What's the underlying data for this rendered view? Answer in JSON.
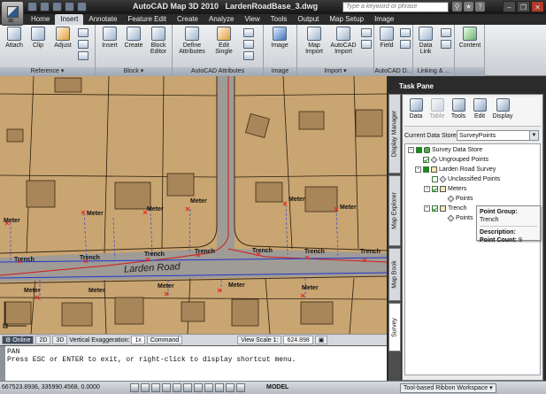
{
  "window": {
    "app_title": "AutoCAD Map 3D 2010",
    "file_name": "LardenRoadBase_3.dwg",
    "app_button_label": "3D",
    "search_placeholder": "Type a keyword or phrase",
    "minimize": "–",
    "restore": "❐",
    "close": "✕"
  },
  "ribbon": {
    "tabs": [
      "Home",
      "Insert",
      "Annotate",
      "Feature Edit",
      "Create",
      "Analyze",
      "View",
      "Tools",
      "Output",
      "Map Setup",
      "Image"
    ],
    "active_tab": "Insert",
    "panels": {
      "reference": {
        "title": "Reference ▾",
        "tools": [
          "Attach",
          "Clip",
          "Adjust"
        ]
      },
      "block": {
        "title": "Block ▾",
        "tools": [
          "Insert",
          "Create",
          "Block Editor"
        ]
      },
      "attributes": {
        "title": "AutoCAD Attributes",
        "tools": [
          "Define Attributes",
          "Edit Single"
        ]
      },
      "image": {
        "title": "Image",
        "tools": [
          "Image"
        ]
      },
      "import": {
        "title": "Import ▾",
        "tools": [
          "Map Import",
          "AutoCAD Import"
        ]
      },
      "data": {
        "title": "AutoCAD D...",
        "tools": [
          "Field"
        ]
      },
      "linking": {
        "title": "Linking & ...",
        "tools": [
          "Data Link"
        ]
      },
      "content": {
        "title": "",
        "tools": [
          "Content"
        ]
      }
    }
  },
  "map": {
    "road_label": "Larden Road",
    "point_labels": {
      "meter": "Meter",
      "trench": "Trench"
    }
  },
  "ucs_bar": {
    "online": "Online",
    "view2d": "2D",
    "view3d": "3D",
    "vert_exag_label": "Vertical Exaggeration:",
    "vert_exag_value": "1x",
    "command": "Command",
    "view_scale_label": "View Scale 1:",
    "view_scale_value": "624.898"
  },
  "command_window": {
    "line1": "PAN",
    "line2": "Press ESC or ENTER to exit, or right-click to display shortcut menu."
  },
  "statusbar": {
    "coordinates": "667523.8936, 335990.4568, 0.0000",
    "model": "MODEL",
    "workspace": "Tool-based Ribbon Workspace ▾"
  },
  "task_pane": {
    "title": "Task Pane",
    "side_tabs": [
      "Display Manager",
      "Map Explorer",
      "Map Book",
      "Survey"
    ],
    "toolbar": [
      "Data",
      "Table",
      "Tools",
      "Edit",
      "Display"
    ],
    "data_store_label": "Current Data Store:",
    "data_store_value": "SurveyPoints",
    "tree": {
      "root": "Survey Data Store",
      "ungrouped": "Ungrouped Points",
      "survey": "Larden Road Survey",
      "unclassified": "Unclassified Points",
      "meters": "Meters",
      "meter_points": "Points",
      "trench": "Trench",
      "trench_points": "Points"
    },
    "tooltip": {
      "group_label": "Point Group:",
      "group_value": "Trench",
      "desc_label": "Description:",
      "count_label": "Point Count:",
      "count_value": "9"
    }
  }
}
